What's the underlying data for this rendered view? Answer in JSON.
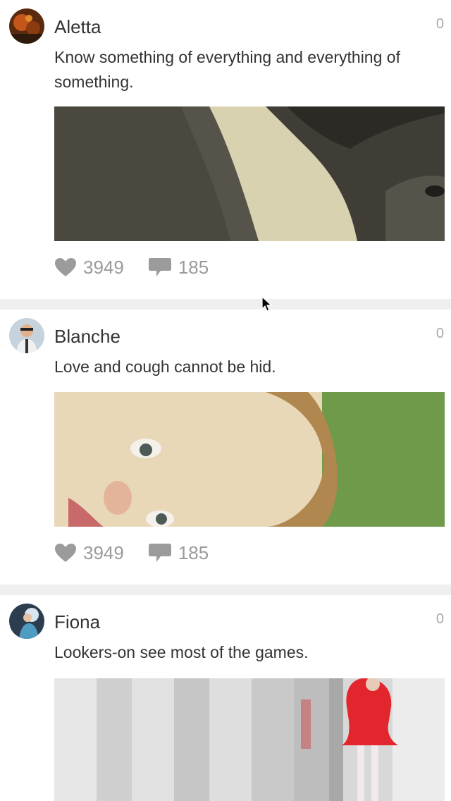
{
  "posts": [
    {
      "username": "Aletta",
      "count": "0",
      "text": "Know something of everything and everything of something.",
      "likes": "3949",
      "comments": "185"
    },
    {
      "username": "Blanche",
      "count": "0",
      "text": "Love and cough cannot be hid.",
      "likes": "3949",
      "comments": "185"
    },
    {
      "username": "Fiona",
      "count": "0",
      "text": "Lookers-on see most of the games."
    }
  ],
  "icons": {
    "like": "heart-icon",
    "comment": "speech-bubble-icon",
    "cursor": "mouse-cursor-icon"
  },
  "colors": {
    "text": "#333333",
    "muted": "#9b9b9b",
    "separator": "#efefef"
  }
}
